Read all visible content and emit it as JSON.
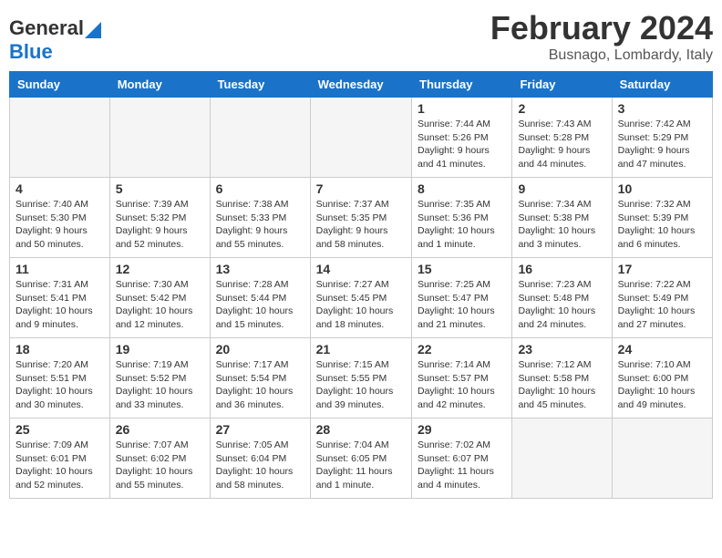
{
  "header": {
    "logo_general": "General",
    "logo_blue": "Blue",
    "month_title": "February 2024",
    "location": "Busnago, Lombardy, Italy"
  },
  "weekdays": [
    "Sunday",
    "Monday",
    "Tuesday",
    "Wednesday",
    "Thursday",
    "Friday",
    "Saturday"
  ],
  "weeks": [
    [
      {
        "day": "",
        "empty": true
      },
      {
        "day": "",
        "empty": true
      },
      {
        "day": "",
        "empty": true
      },
      {
        "day": "",
        "empty": true
      },
      {
        "day": "1",
        "sunrise": "7:44 AM",
        "sunset": "5:26 PM",
        "daylight": "9 hours and 41 minutes."
      },
      {
        "day": "2",
        "sunrise": "7:43 AM",
        "sunset": "5:28 PM",
        "daylight": "9 hours and 44 minutes."
      },
      {
        "day": "3",
        "sunrise": "7:42 AM",
        "sunset": "5:29 PM",
        "daylight": "9 hours and 47 minutes."
      }
    ],
    [
      {
        "day": "4",
        "sunrise": "7:40 AM",
        "sunset": "5:30 PM",
        "daylight": "9 hours and 50 minutes."
      },
      {
        "day": "5",
        "sunrise": "7:39 AM",
        "sunset": "5:32 PM",
        "daylight": "9 hours and 52 minutes."
      },
      {
        "day": "6",
        "sunrise": "7:38 AM",
        "sunset": "5:33 PM",
        "daylight": "9 hours and 55 minutes."
      },
      {
        "day": "7",
        "sunrise": "7:37 AM",
        "sunset": "5:35 PM",
        "daylight": "9 hours and 58 minutes."
      },
      {
        "day": "8",
        "sunrise": "7:35 AM",
        "sunset": "5:36 PM",
        "daylight": "10 hours and 1 minute."
      },
      {
        "day": "9",
        "sunrise": "7:34 AM",
        "sunset": "5:38 PM",
        "daylight": "10 hours and 3 minutes."
      },
      {
        "day": "10",
        "sunrise": "7:32 AM",
        "sunset": "5:39 PM",
        "daylight": "10 hours and 6 minutes."
      }
    ],
    [
      {
        "day": "11",
        "sunrise": "7:31 AM",
        "sunset": "5:41 PM",
        "daylight": "10 hours and 9 minutes."
      },
      {
        "day": "12",
        "sunrise": "7:30 AM",
        "sunset": "5:42 PM",
        "daylight": "10 hours and 12 minutes."
      },
      {
        "day": "13",
        "sunrise": "7:28 AM",
        "sunset": "5:44 PM",
        "daylight": "10 hours and 15 minutes."
      },
      {
        "day": "14",
        "sunrise": "7:27 AM",
        "sunset": "5:45 PM",
        "daylight": "10 hours and 18 minutes."
      },
      {
        "day": "15",
        "sunrise": "7:25 AM",
        "sunset": "5:47 PM",
        "daylight": "10 hours and 21 minutes."
      },
      {
        "day": "16",
        "sunrise": "7:23 AM",
        "sunset": "5:48 PM",
        "daylight": "10 hours and 24 minutes."
      },
      {
        "day": "17",
        "sunrise": "7:22 AM",
        "sunset": "5:49 PM",
        "daylight": "10 hours and 27 minutes."
      }
    ],
    [
      {
        "day": "18",
        "sunrise": "7:20 AM",
        "sunset": "5:51 PM",
        "daylight": "10 hours and 30 minutes."
      },
      {
        "day": "19",
        "sunrise": "7:19 AM",
        "sunset": "5:52 PM",
        "daylight": "10 hours and 33 minutes."
      },
      {
        "day": "20",
        "sunrise": "7:17 AM",
        "sunset": "5:54 PM",
        "daylight": "10 hours and 36 minutes."
      },
      {
        "day": "21",
        "sunrise": "7:15 AM",
        "sunset": "5:55 PM",
        "daylight": "10 hours and 39 minutes."
      },
      {
        "day": "22",
        "sunrise": "7:14 AM",
        "sunset": "5:57 PM",
        "daylight": "10 hours and 42 minutes."
      },
      {
        "day": "23",
        "sunrise": "7:12 AM",
        "sunset": "5:58 PM",
        "daylight": "10 hours and 45 minutes."
      },
      {
        "day": "24",
        "sunrise": "7:10 AM",
        "sunset": "6:00 PM",
        "daylight": "10 hours and 49 minutes."
      }
    ],
    [
      {
        "day": "25",
        "sunrise": "7:09 AM",
        "sunset": "6:01 PM",
        "daylight": "10 hours and 52 minutes."
      },
      {
        "day": "26",
        "sunrise": "7:07 AM",
        "sunset": "6:02 PM",
        "daylight": "10 hours and 55 minutes."
      },
      {
        "day": "27",
        "sunrise": "7:05 AM",
        "sunset": "6:04 PM",
        "daylight": "10 hours and 58 minutes."
      },
      {
        "day": "28",
        "sunrise": "7:04 AM",
        "sunset": "6:05 PM",
        "daylight": "11 hours and 1 minute."
      },
      {
        "day": "29",
        "sunrise": "7:02 AM",
        "sunset": "6:07 PM",
        "daylight": "11 hours and 4 minutes."
      },
      {
        "day": "",
        "empty": true
      },
      {
        "day": "",
        "empty": true
      }
    ]
  ]
}
